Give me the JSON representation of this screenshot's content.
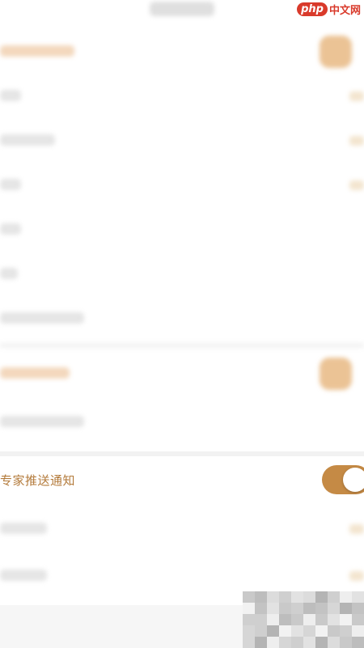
{
  "notification_setting": {
    "label": "专家推送通知",
    "enabled": true
  },
  "watermark": {
    "logo": "php",
    "text": "中文网"
  },
  "colors": {
    "accent": "#c58a45",
    "label": "#b37a3a",
    "watermark_red": "#d93a2b"
  }
}
